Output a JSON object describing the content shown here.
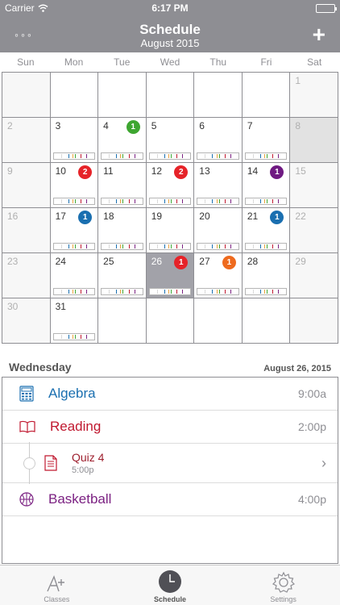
{
  "status": {
    "carrier": "Carrier",
    "time": "6:17 PM"
  },
  "nav": {
    "title": "Schedule",
    "subtitle": "August 2015",
    "menu_label": "◦◦◦",
    "add_label": "+"
  },
  "weekdays": [
    "Sun",
    "Mon",
    "Tue",
    "Wed",
    "Thu",
    "Fri",
    "Sat"
  ],
  "colors": {
    "algebra": "#1a6fb0",
    "reading": "#c0182f",
    "basketball": "#7b2182",
    "green": "#3ea631",
    "red": "#e62329",
    "purple": "#6f1a82",
    "blue": "#1a6fb0",
    "orange": "#ee6a1e"
  },
  "calendar": {
    "days": [
      {
        "n": ""
      },
      {
        "n": ""
      },
      {
        "n": ""
      },
      {
        "n": ""
      },
      {
        "n": ""
      },
      {
        "n": ""
      },
      {
        "n": "1"
      },
      {
        "n": "2"
      },
      {
        "n": "3",
        "bar": true
      },
      {
        "n": "4",
        "bar": true,
        "badge": "1",
        "badge_color": "green"
      },
      {
        "n": "5",
        "bar": true
      },
      {
        "n": "6",
        "bar": true
      },
      {
        "n": "7",
        "bar": true
      },
      {
        "n": "8"
      },
      {
        "n": "9"
      },
      {
        "n": "10",
        "bar": true,
        "badge": "2",
        "badge_color": "red"
      },
      {
        "n": "11",
        "bar": true
      },
      {
        "n": "12",
        "bar": true,
        "badge": "2",
        "badge_color": "red"
      },
      {
        "n": "13",
        "bar": true
      },
      {
        "n": "14",
        "bar": true,
        "badge": "1",
        "badge_color": "purple"
      },
      {
        "n": "15"
      },
      {
        "n": "16"
      },
      {
        "n": "17",
        "bar": true,
        "badge": "1",
        "badge_color": "blue"
      },
      {
        "n": "18",
        "bar": true
      },
      {
        "n": "19",
        "bar": true
      },
      {
        "n": "20",
        "bar": true
      },
      {
        "n": "21",
        "bar": true,
        "badge": "1",
        "badge_color": "blue"
      },
      {
        "n": "22"
      },
      {
        "n": "23"
      },
      {
        "n": "24",
        "bar": true
      },
      {
        "n": "25",
        "bar": true
      },
      {
        "n": "26",
        "bar": true,
        "badge": "1",
        "badge_color": "red",
        "selected": true
      },
      {
        "n": "27",
        "bar": true,
        "badge": "1",
        "badge_color": "orange"
      },
      {
        "n": "28",
        "bar": true
      },
      {
        "n": "29"
      },
      {
        "n": "30"
      },
      {
        "n": "31",
        "bar": true
      },
      {
        "n": ""
      },
      {
        "n": ""
      },
      {
        "n": ""
      },
      {
        "n": ""
      },
      {
        "n": ""
      }
    ]
  },
  "agenda": {
    "day": "Wednesday",
    "date": "August 26, 2015",
    "items": [
      {
        "label": "Algebra",
        "time": "9:00a",
        "icon": "calculator-icon"
      },
      {
        "label": "Reading",
        "time": "2:00p",
        "icon": "book-icon"
      },
      {
        "label": "Basketball",
        "time": "4:00p",
        "icon": "basketball-icon"
      }
    ],
    "quiz": {
      "label": "Quiz 4",
      "time": "5:00p",
      "icon": "document-icon"
    }
  },
  "tabs": [
    {
      "label": "Classes",
      "icon": "grade-a-plus-icon"
    },
    {
      "label": "Schedule",
      "icon": "clock-icon"
    },
    {
      "label": "Settings",
      "icon": "gear-icon"
    }
  ]
}
